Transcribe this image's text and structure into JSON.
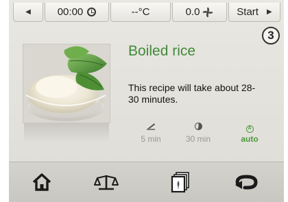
{
  "status_bar": {
    "left_arrow": "◀",
    "time": "00:00",
    "temperature": "--°C",
    "pressure": "0.0",
    "start_label": "Start",
    "right_arrow": "▶"
  },
  "step": {
    "number": "3"
  },
  "recipe": {
    "title": "Boiled rice",
    "description": "This recipe will take about 28-30 minutes."
  },
  "options": [
    {
      "label": "5 min",
      "icon": "knife-icon",
      "selected": false
    },
    {
      "label": "30 min",
      "icon": "half-disc-icon",
      "selected": false
    },
    {
      "label": "auto",
      "icon": "auto-icon",
      "selected": true
    }
  ],
  "nav": [
    {
      "icon": "home-icon"
    },
    {
      "icon": "scale-icon"
    },
    {
      "icon": "recipe-book-icon"
    },
    {
      "icon": "back-icon"
    }
  ],
  "colors": {
    "accent_green": "#3f8a3a",
    "background": "#e6e4df",
    "nav_background": "#cfcdc7"
  }
}
